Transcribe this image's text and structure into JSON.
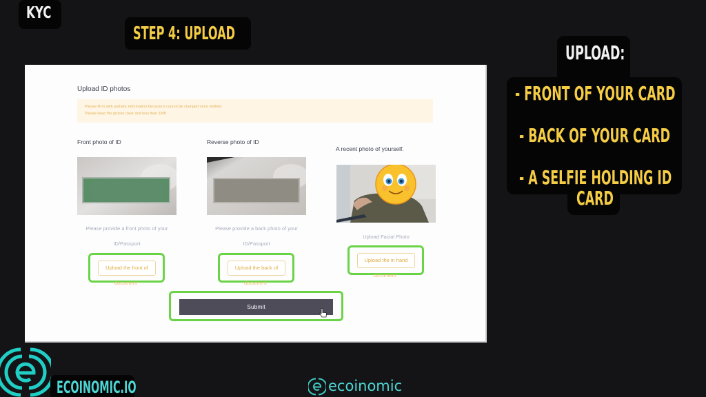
{
  "overlay": {
    "kyc_tag": "KYC",
    "step_tag": "STEP 4: UPLOAD",
    "callout": {
      "title": "UPLOAD:",
      "items": [
        "- FRONT OF YOUR CARD",
        "- BACK OF YOUR CARD",
        "- A SELFIE HOLDING ID",
        "CARD"
      ]
    },
    "brand_tag": "ECOINOMIC.IO",
    "watermark": "ecoinomic",
    "colors": {
      "accent_yellow": "#f5cd45",
      "brand_teal": "#4dd6d3",
      "highlight_green": "#6ad446"
    }
  },
  "form": {
    "heading": "Upload ID photos",
    "notice": [
      "Please fill in with authetic information because it cannot be changed once verified.",
      "Please keep the picture clear and less than 1MB"
    ],
    "columns": [
      {
        "label": "Front photo of ID",
        "hint_line1": "Please provide a front photo of your",
        "hint_line2": "ID/Passport",
        "button": "Upload the front of",
        "button_overflow": "document"
      },
      {
        "label": "Reverse photo of ID",
        "hint_line1": "Please provide a back photo of your",
        "hint_line2": "ID/Passport",
        "button": "Upload the back of",
        "button_overflow": "document"
      },
      {
        "label": "A recent photo of yourself.",
        "hint_line1": "Upload Facial Photo",
        "button": "Upload the in hand",
        "button_overflow": "document"
      }
    ],
    "submit": "Submit"
  }
}
